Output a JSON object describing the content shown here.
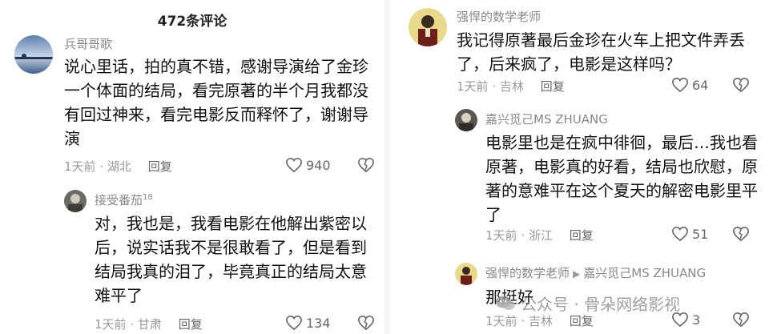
{
  "header": {
    "comment_count_title": "472条评论"
  },
  "left": {
    "comment1": {
      "user": "兵哥哥歌",
      "text": "说心里话，拍的真不错，感谢导演给了金珍一个体面的结局，看完原著的半个月我都没有回过神来，看完电影反而释怀了，谢谢导演",
      "time": "1天前",
      "location": "湖北",
      "reply_label": "回复",
      "likes": "940"
    },
    "reply1": {
      "user": "接受番茄",
      "user_badge": "18",
      "text": "对，我也是，我看电影在他解出紫密以后，说实话我不是很敢看了，但是看到结局我真的泪了，毕竟真正的结局太意难平了",
      "time": "1天前",
      "location": "甘肃",
      "reply_label": "回复",
      "likes": "134"
    }
  },
  "right": {
    "comment1": {
      "user": "强悍的数学老师",
      "text": "我记得原著最后金珍在火车上把文件弄丢了，后来疯了，电影是这样吗？",
      "time": "1天前",
      "location": "吉林",
      "reply_label": "回复",
      "likes": "64"
    },
    "reply1": {
      "user": "嘉兴觅己MS ZHUANG",
      "text": "电影里也是在疯中徘徊，最后…我也看原著，电影真的好看，结局也欣慰，原著的意难平在这个夏天的解密电影里平了",
      "time": "1天前",
      "location": "浙江",
      "reply_label": "回复",
      "likes": "51"
    },
    "reply2": {
      "user": "强悍的数学老师",
      "reply_to": "嘉兴觅己MS ZHUANG",
      "text": "那挺好",
      "time": "1天前",
      "location": "吉林",
      "reply_label": "回复",
      "likes": "3"
    }
  },
  "watermark": {
    "text": "公众号 · 骨朵网络影视"
  },
  "separator": "·",
  "icons": {
    "like": "heart-outline-icon",
    "dislike": "broken-heart-icon",
    "reply_arrow": "triangle-right-icon",
    "watermark": "wechat-icon"
  }
}
